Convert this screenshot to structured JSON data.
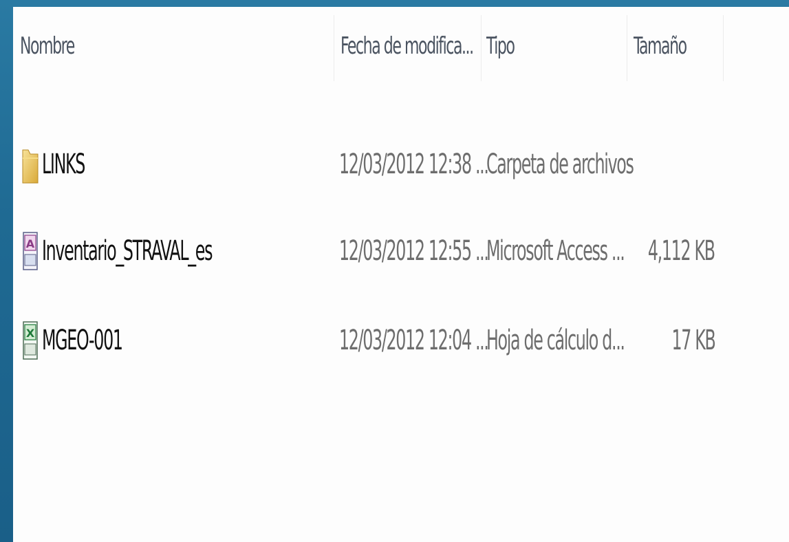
{
  "columns": {
    "name": "Nombre",
    "date": "Fecha de modifica...",
    "type": "Tipo",
    "size": "Tamaño"
  },
  "files": [
    {
      "name": "LINKS",
      "date": "12/03/2012 12:38 ...",
      "type": "Carpeta de archivos",
      "size": "",
      "icon": "folder-icon"
    },
    {
      "name": "Inventario_STRAVAL_es",
      "date": "12/03/2012 12:55 ...",
      "type": "Microsoft Access ...",
      "size": "4,112 KB",
      "icon": "access-file-icon"
    },
    {
      "name": "MGEO-001",
      "date": "12/03/2012 12:04 ...",
      "type": "Hoja de cálculo d...",
      "size": "17 KB",
      "icon": "excel-file-icon"
    }
  ],
  "colors": {
    "background": "#1f6a93",
    "pane": "#fdfdfd",
    "name_text": "#111111",
    "meta_text": "#6d6d6d"
  }
}
